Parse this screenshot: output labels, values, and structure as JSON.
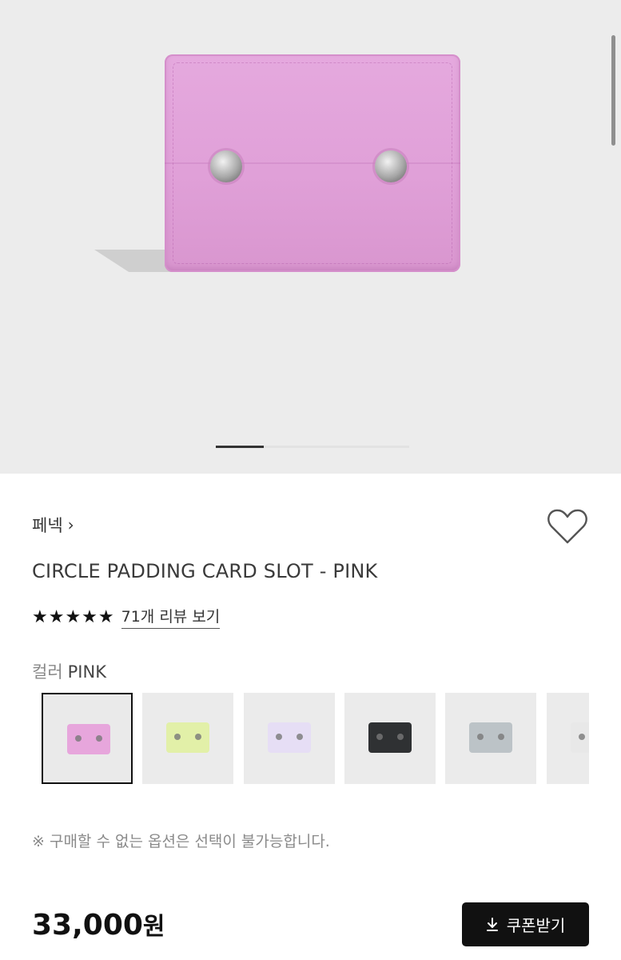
{
  "brand": {
    "name": "페넥"
  },
  "product": {
    "title": "CIRCLE PADDING CARD SLOT - PINK",
    "rating_stars": "★★★★★",
    "review_link": "71개 리뷰 보기"
  },
  "color": {
    "label": "컬러",
    "selected": "PINK",
    "swatches": [
      {
        "color": "#e7a6dc"
      },
      {
        "color": "#e2f0a8"
      },
      {
        "color": "#e6def5"
      },
      {
        "color": "#2f3133"
      },
      {
        "color": "#bcc3c7"
      },
      {
        "color": "#e8e8e8"
      }
    ]
  },
  "notice": "※ 구매할 수 없는 옵션은 선택이 불가능합니다.",
  "price": {
    "amount": "33,000",
    "unit": "원"
  },
  "coupon_button": "쿠폰받기",
  "gallery": {
    "current_index": 1,
    "total": 4
  },
  "colors": {
    "accent": "#111111",
    "wallet": "#e0a0d8"
  }
}
